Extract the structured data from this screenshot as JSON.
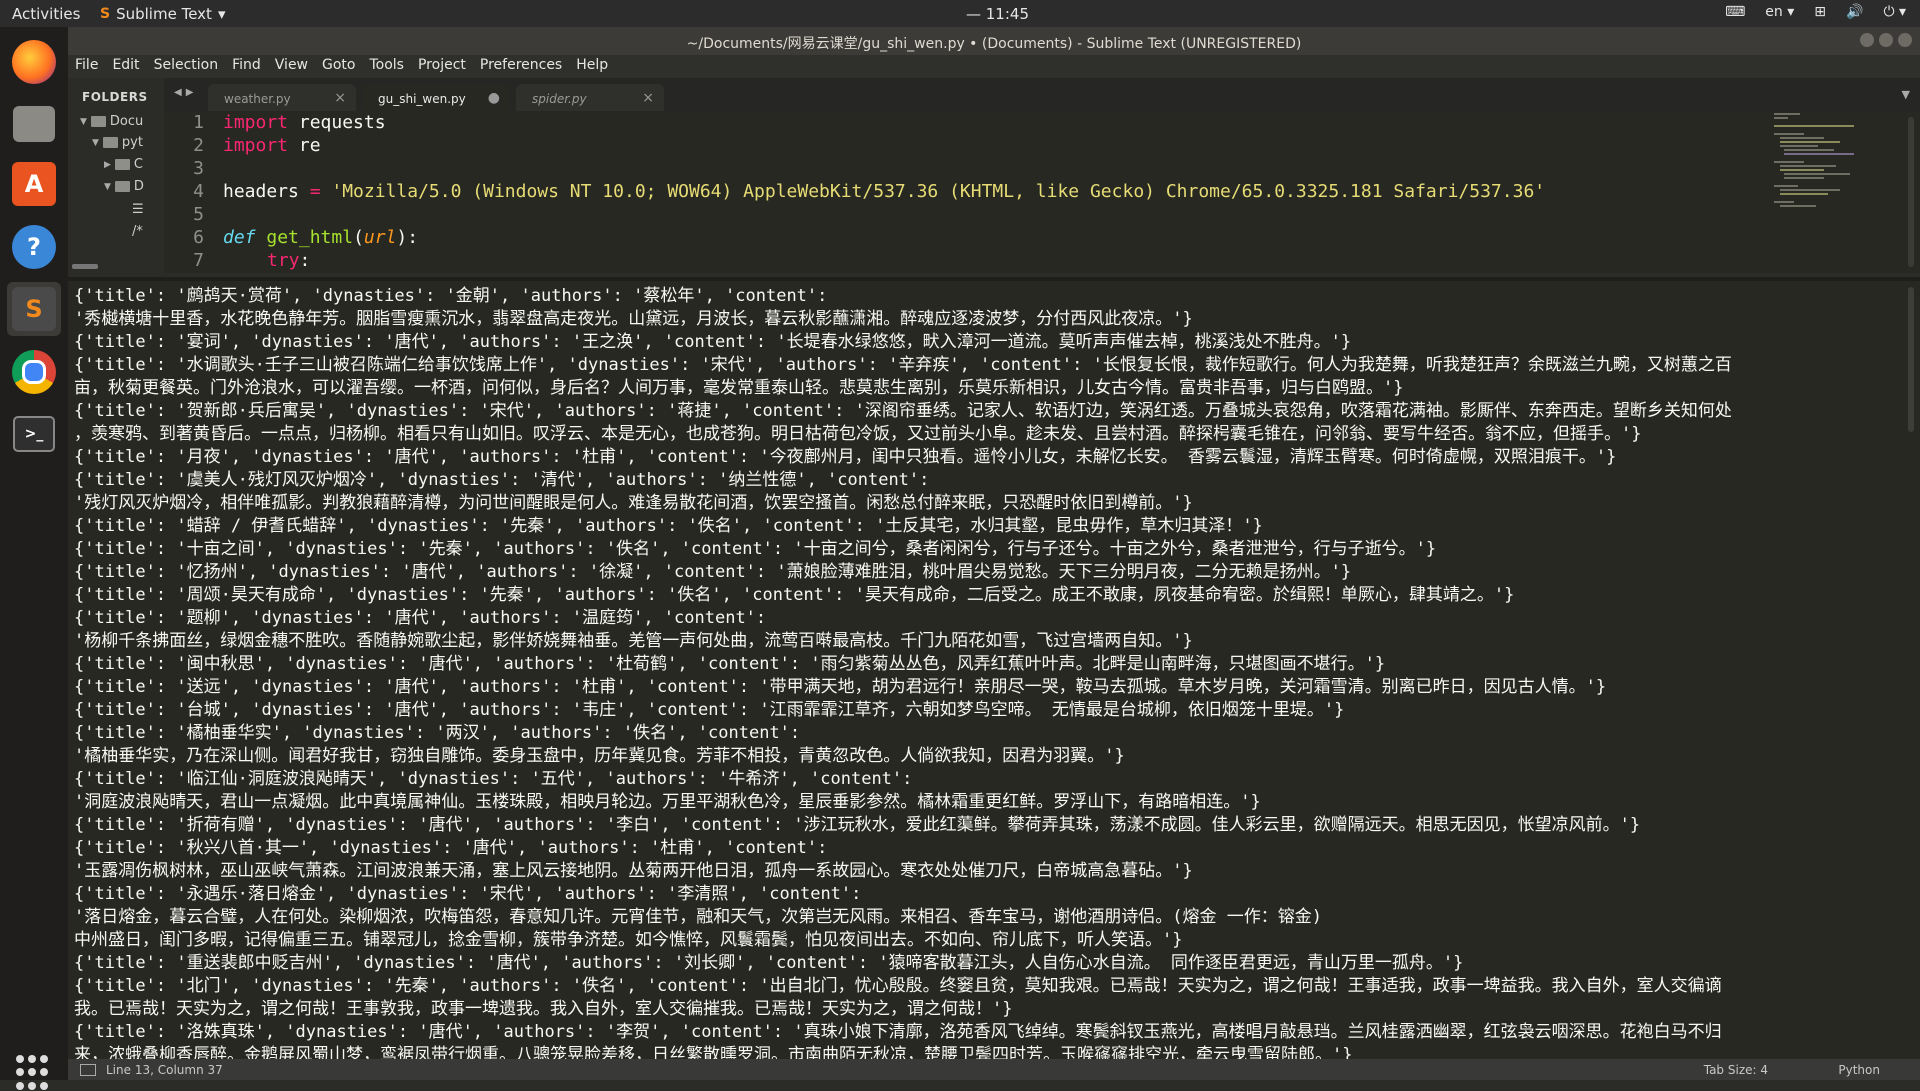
{
  "topbar": {
    "activities": "Activities",
    "app_name": "Sublime Text",
    "app_arrow": "▾",
    "clock": "— 11:45",
    "lang": "en",
    "lang_arrow": "▾",
    "power_arrow": "▾"
  },
  "window": {
    "title": "~/Documents/网易云课堂/gu_shi_wen.py • (Documents) - Sublime Text (UNREGISTERED)"
  },
  "menu": [
    "File",
    "Edit",
    "Selection",
    "Find",
    "View",
    "Goto",
    "Tools",
    "Project",
    "Preferences",
    "Help"
  ],
  "sidebar": {
    "header": "FOLDERS",
    "items": [
      "Docu",
      "pyt",
      "C",
      "D",
      "",
      ""
    ]
  },
  "tabs": [
    {
      "label": "weather.py",
      "close": "×"
    },
    {
      "label": "gu_shi_wen.py",
      "close": "●"
    },
    {
      "label": "spider.py",
      "close": "×"
    }
  ],
  "editor": {
    "line_numbers": [
      "1",
      "2",
      "3",
      "4",
      "5",
      "6",
      "7"
    ],
    "import_kw": "import",
    "mod_requests": " requests",
    "mod_re": " re",
    "headers_var": "headers ",
    "eq": "=",
    "headers_val": " 'Mozilla/5.0 (Windows NT 10.0; WOW64) AppleWebKit/537.36 (KHTML, like Gecko) Chrome/65.0.3325.181 Safari/537.36'",
    "def_kw": "def",
    "fn_name": " get_html",
    "paren_open": "(",
    "arg": "url",
    "paren_close": "):",
    "try_kw": "try",
    "try_colon": ":"
  },
  "output_lines": [
    "{'title': '鹧鸪天·赏荷', 'dynasties': '金朝', 'authors': '蔡松年', 'content':",
    "'秀樾横塘十里香，水花晚色静年芳。胭脂雪瘦熏沉水，翡翠盘高走夜光。山黛远，月波长，暮云秋影蘸潇湘。醉魂应逐凌波梦，分付西风此夜凉。'}",
    "{'title': '宴词', 'dynasties': '唐代', 'authors': '王之涣', 'content': '长堤春水绿悠悠，畎入漳河一道流。莫听声声催去棹，桃溪浅处不胜舟。'}",
    "{'title': '水调歌头·壬子三山被召陈端仁给事饮饯席上作', 'dynasties': '宋代', 'authors': '辛弃疾', 'content': '长恨复长恨，裁作短歌行。何人为我楚舞，听我楚狂声？余既滋兰九畹，又树蕙之百",
    "亩，秋菊更餐英。门外沧浪水，可以濯吾缨。一杯酒，问何似，身后名？人间万事，毫发常重泰山轻。悲莫悲生离别，乐莫乐新相识，儿女古今情。富贵非吾事，归与白鸥盟。'}",
    "{'title': '贺新郎·兵后寓吴', 'dynasties': '宋代', 'authors': '蒋捷', 'content': '深阁帘垂绣。记家人、软语灯边，笑涡红透。万叠城头哀怨角，吹落霜花满袖。影厮伴、东奔西走。望断乡关知何处",
    "，羡寒鸦、到著黄昏后。一点点，归杨柳。相看只有山如旧。叹浮云、本是无心，也成苍狗。明日枯荷包冷饭，又过前头小阜。趁未发、且尝村酒。醉探枵囊毛锥在，问邻翁、要写牛经否。翁不应，但摇手。'}",
    "{'title': '月夜', 'dynasties': '唐代', 'authors': '杜甫', 'content': '今夜鄜州月，闺中只独看。遥怜小儿女，未解忆长安。 香雾云鬟湿，清辉玉臂寒。何时倚虚幌，双照泪痕干。'}",
    "{'title': '虞美人·残灯风灭炉烟冷', 'dynasties': '清代', 'authors': '纳兰性德', 'content':",
    "'残灯风灭炉烟冷，相伴唯孤影。判教狼藉醉清樽，为问世间醒眼是何人。难逢易散花间酒，饮罢空搔首。闲愁总付醉来眠，只恐醒时依旧到樽前。'}",
    "{'title': '蜡辞 / 伊耆氏蜡辞', 'dynasties': '先秦', 'authors': '佚名', 'content': '土反其宅，水归其壑，昆虫毋作，草木归其泽！'}",
    "{'title': '十亩之间', 'dynasties': '先秦', 'authors': '佚名', 'content': '十亩之间兮，桑者闲闲兮，行与子还兮。十亩之外兮，桑者泄泄兮，行与子逝兮。'}",
    "{'title': '忆扬州', 'dynasties': '唐代', 'authors': '徐凝', 'content': '萧娘脸薄难胜泪，桃叶眉尖易觉愁。天下三分明月夜，二分无赖是扬州。'}",
    "{'title': '周颂·昊天有成命', 'dynasties': '先秦', 'authors': '佚名', 'content': '昊天有成命，二后受之。成王不敢康，夙夜基命宥密。於缉熙！单厥心，肆其靖之。'}",
    "{'title': '题柳', 'dynasties': '唐代', 'authors': '温庭筠', 'content':",
    "'杨柳千条拂面丝，绿烟金穗不胜吹。香随静婉歌尘起，影伴娇娆舞袖垂。羌管一声何处曲，流莺百啭最高枝。千门九陌花如雪，飞过宫墙两自知。'}",
    "{'title': '闽中秋思', 'dynasties': '唐代', 'authors': '杜荀鹤', 'content': '雨匀紫菊丛丛色，风弄红蕉叶叶声。北畔是山南畔海，只堪图画不堪行。'}",
    "{'title': '送远', 'dynasties': '唐代', 'authors': '杜甫', 'content': '带甲满天地，胡为君远行！亲朋尽一哭，鞍马去孤城。草木岁月晚，关河霜雪清。别离已昨日，因见古人情。'}",
    "{'title': '台城', 'dynasties': '唐代', 'authors': '韦庄', 'content': '江雨霏霏江草齐，六朝如梦鸟空啼。 无情最是台城柳，依旧烟笼十里堤。'}",
    "{'title': '橘柚垂华实', 'dynasties': '两汉', 'authors': '佚名', 'content':",
    "'橘柚垂华实，乃在深山侧。闻君好我甘，窃独自雕饰。委身玉盘中，历年冀见食。芳菲不相投，青黄忽改色。人倘欲我知，因君为羽翼。'}",
    "{'title': '临江仙·洞庭波浪飐晴天', 'dynasties': '五代', 'authors': '牛希济', 'content':",
    "'洞庭波浪飐晴天，君山一点凝烟。此中真境属神仙。玉楼珠殿，相映月轮边。万里平湖秋色冷，星辰垂影参然。橘林霜重更红鲜。罗浮山下，有路暗相连。'}",
    "{'title': '折荷有赠', 'dynasties': '唐代', 'authors': '李白', 'content': '涉江玩秋水，爱此红蕖鲜。攀荷弄其珠，荡漾不成圆。佳人彩云里，欲赠隔远天。相思无因见，怅望凉风前。'}",
    "{'title': '秋兴八首·其一', 'dynasties': '唐代', 'authors': '杜甫', 'content':",
    "'玉露凋伤枫树林，巫山巫峡气萧森。江间波浪兼天涌，塞上风云接地阴。丛菊两开他日泪，孤舟一系故园心。寒衣处处催刀尺，白帝城高急暮砧。'}",
    "{'title': '永遇乐·落日熔金', 'dynasties': '宋代', 'authors': '李清照', 'content':",
    "'落日熔金，暮云合璧，人在何处。染柳烟浓，吹梅笛怨，春意知几许。元宵佳节，融和天气，次第岂无风雨。来相召、香车宝马，谢他酒朋诗侣。(熔金 一作：镕金)",
    "中州盛日，闺门多暇，记得偏重三五。铺翠冠儿，捻金雪柳，簇带争济楚。如今憔悴，风鬟霜鬓，怕见夜间出去。不如向、帘儿底下，听人笑语。'}",
    "{'title': '重送裴郎中贬吉州', 'dynasties': '唐代', 'authors': '刘长卿', 'content': '猿啼客散暮江头，人自伤心水自流。 同作逐臣君更远，青山万里一孤舟。'}",
    "{'title': '北门', 'dynasties': '先秦', 'authors': '佚名', 'content': '出自北门，忧心殷殷。终窭且贫，莫知我艰。已焉哉！天实为之，谓之何哉！王事适我，政事一埤益我。我入自外，室人交徧谪",
    "我。已焉哉！天实为之，谓之何哉！王事敦我，政事一埤遗我。我入自外，室人交徧摧我。已焉哉！天实为之，谓之何哉！'}",
    "{'title': '洛姝真珠', 'dynasties': '唐代', 'authors': '李贺', 'content': '真珠小娘下清廓，洛苑香风飞绰绰。寒鬓斜钗玉燕光，高楼唱月敲悬珰。兰风桂露洒幽翠，红弦袅云咽深思。花袍白马不归",
    "来，浓蛾叠柳香唇醉。金鹅屏风蜀山梦，鸾裾凤带行烟重。八骢笼晃脸差移，日丝繁散曛罗洞。市南曲陌无秋凉，楚腰卫鬓四时芳。玉喉窱窱排空光，牵云曳雪留陆郎。'}"
  ],
  "status": {
    "position": "Line 13, Column 37",
    "tab_size": "Tab Size: 4",
    "syntax": "Python"
  }
}
